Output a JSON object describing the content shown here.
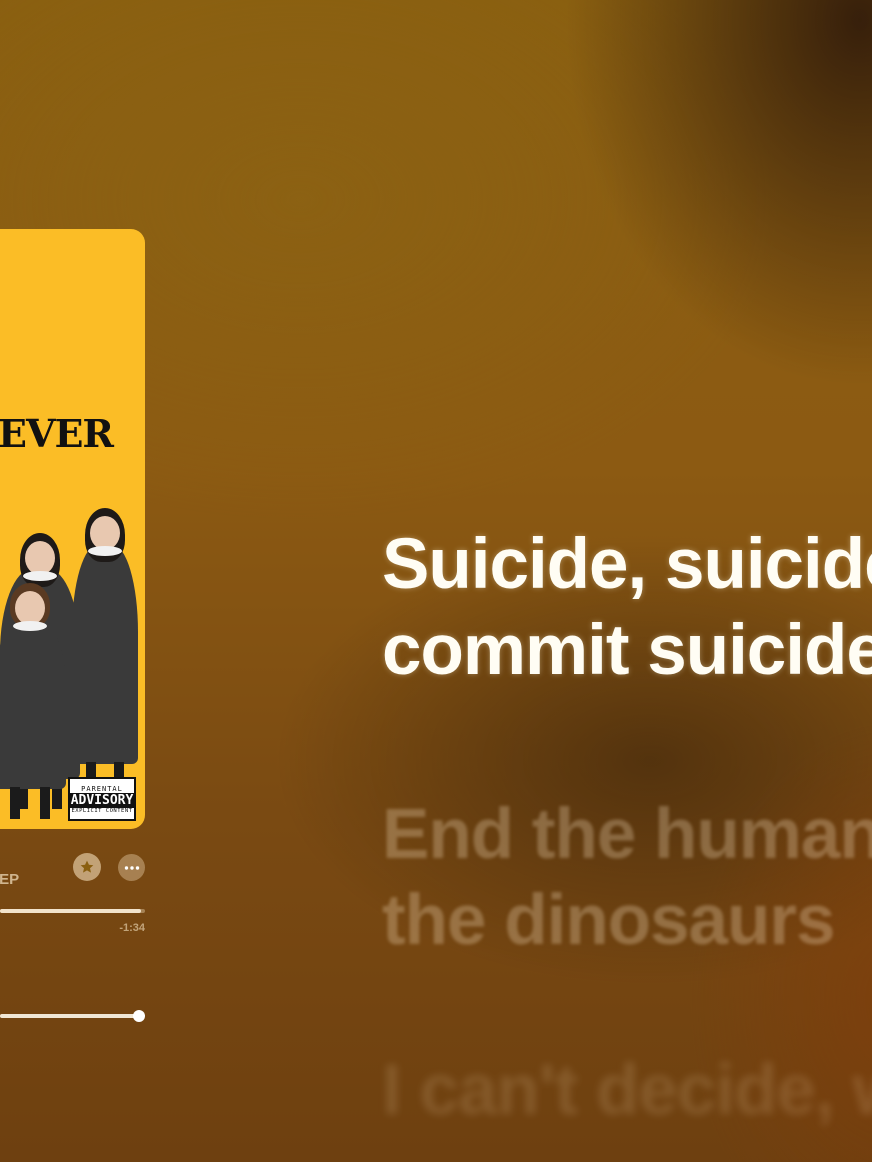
{
  "player": {
    "album_subtitle": "r - EP",
    "time_remaining": "-1:34",
    "progress": 0.97,
    "volume": 0.97
  },
  "album_art": {
    "title_art": "EVER",
    "advisory_line1": "PARENTAL",
    "advisory_line2": "ADVISORY",
    "advisory_line3": "EXPLICIT CONTENT"
  },
  "lyrics": {
    "active_line1": "Suicide, suicide",
    "active_line2": "commit suicide",
    "next_line1": "End the human",
    "next_line2": "the dinosaurs",
    "later_line1": "I can't decide, w"
  },
  "icons": {
    "favorite": "star-icon",
    "more": "ellipsis-icon"
  },
  "colors": {
    "album_bg": "#fbbd26",
    "background": "#8a5f10",
    "lyric_active": "#fffdf4"
  }
}
